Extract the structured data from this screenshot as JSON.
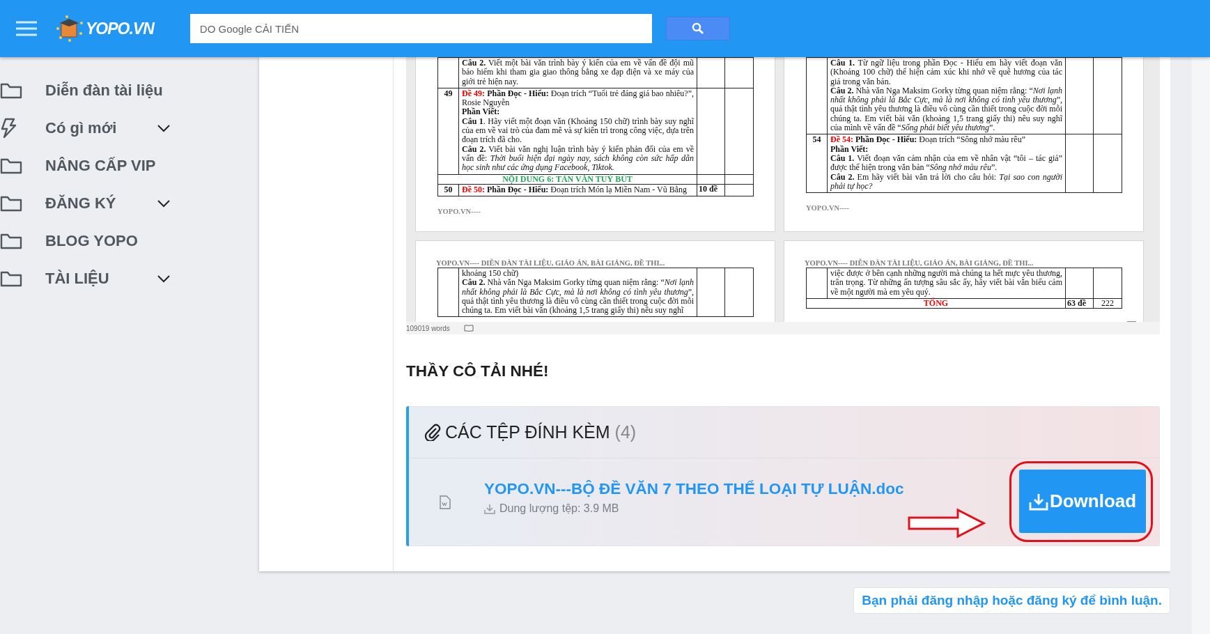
{
  "header": {
    "logo_text": "YOPO.VN",
    "search": {
      "placeholder": "DO Google CẢI TIẾN"
    }
  },
  "sidebar": {
    "items": [
      {
        "label": "Diễn đàn tài liệu",
        "kind": "folder",
        "expandable": false
      },
      {
        "label": "Có gì mới",
        "kind": "bolt",
        "expandable": true
      },
      {
        "label": "NÂNG CẤP VIP",
        "kind": "folder",
        "expandable": false
      },
      {
        "label": "ĐĂNG KÝ",
        "kind": "folder",
        "expandable": true
      },
      {
        "label": "BLOG YOPO",
        "kind": "folder",
        "expandable": false
      },
      {
        "label": "TÀI LIỆU",
        "kind": "folder",
        "expandable": true
      }
    ]
  },
  "document_preview": {
    "pages": [
      {
        "rows": [
          {
            "kind": "entry",
            "paragraphs": [
              {
                "text": "**Câu 2.** Viết một bài văn trình bày ý kiến của em về vấn đề đội mũ bảo hiểm khi tham gia giao thông bằng xe đạp điện và xe máy của giới trẻ hiện nay."
              }
            ]
          },
          {
            "kind": "entry",
            "number": "49",
            "paragraphs": [
              {
                "label": "Đề 49:",
                "text": "**Phần Đọc - Hiểu:** Đoạn trích “Tuổi trẻ đáng giá bao nhiêu?”, Rosie Nguyễn"
              },
              {
                "text": "**Phần Viết:**"
              },
              {
                "text": "**Câu 1**. Hãy viết một đoạn văn (Khoảng 150 chữ) trình bày suy nghĩ của em về vai trò của đam mê và sự kiên trì trong công việc, dựa trên đoạn trích đã cho."
              },
              {
                "text": "**Câu 2.** Viết bài văn nghị luận trình bày ý kiến phản đối của em về vấn đề: *Thời buổi hiện đại ngày nay, sách không còn sức hấp dẫn học sinh như các ứng dụng Facebook, Tiktok.*"
              }
            ]
          },
          {
            "kind": "section",
            "title": "NỘI DUNG 6: TẢN VĂN TUỲ BÚT"
          },
          {
            "kind": "entry",
            "number": "50",
            "paragraphs": [
              {
                "label": "Đề 50:",
                "text": "**Phần Đọc - Hiểu:** Đoạn trích Món lạ Miền Nam - Vũ Bằng"
              }
            ],
            "column_3": "10 đề"
          }
        ],
        "footer": "YOPO.VN----"
      },
      {
        "rows": [
          {
            "kind": "entry",
            "paragraphs": [
              {
                "text": "**Câu 1.** Từ ngữ liệu trong phần Đọc - Hiểu em hãy viết đoạn văn (Khoảng 100 chữ) thể hiện cảm xúc khi nhớ về quê hương của tác giả trong văn bản."
              },
              {
                "text": "**Câu 2.** Nhà văn Nga Maksim Gorky từng quan niệm rằng: “*Nơi lạnh nhất không phải là Bắc Cực, mà là nơi không có tình yêu thương*”, quả thật tình yêu thương là điều vô cùng cần thiết trong cuộc đời mỗi chúng ta. Em viết bài văn (khoảng 1,5 trang giấy thi) nêu suy nghĩ của mình về vấn đề “*Sống phải biết yêu thương*”."
              }
            ]
          },
          {
            "kind": "entry",
            "number": "54",
            "paragraphs": [
              {
                "label": "Đề 54:",
                "text": "**Phần Đọc - Hiểu:** Đoạn trích “Sông nhớ màu rêu”"
              },
              {
                "text": "**Phần Viết:**"
              },
              {
                "text": "**Câu 1.** Viết đoạn văn cảm nhận của em về nhân vật “tôi – tác giả” được thể hiện trong văn bản “*Sông nhớ màu rêu*”."
              },
              {
                "text": "**Câu 2.** Em hãy viết bài văn trả lời cho câu hỏi: *Tại sao con người phải tự học?*"
              }
            ]
          }
        ],
        "footer": "YOPO.VN----"
      },
      {
        "header": "YOPO.VN---- DIỄN ĐÀN TÀI LIỆU, GIÁO ÁN, BÀI GIẢNG, ĐỀ THI...",
        "rows": [
          {
            "kind": "entry",
            "paragraphs": [
              {
                "text": "khoảng 150 chữ)"
              },
              {
                "text": "**Câu 2.**  Nhà văn Nga Maksim Gorky từng quan niệm rằng: “*Nơi lạnh nhất không phải là Bắc Cực, mà là nơi không có tình yêu thương*”, quả thật tình yêu thương là điều vô cùng cần thiết trong cuộc đời mỗi chúng ta. Em viết bài văn (khoảng 1,5 trang giấy thi) nêu suy nghĩ"
              }
            ]
          }
        ]
      },
      {
        "header": "YOPO.VN---- DIỄN ĐÀN TÀI LIỆU, GIÁO ÁN, BÀI GIẢNG, ĐỀ THI...",
        "rows": [
          {
            "kind": "entry",
            "paragraphs": [
              {
                "text": "việc được ở bên cạnh những người mà chúng ta hết mực yêu thương, trân trọng. Từ những ấn tượng sâu sắc ấy, hãy viết bài văn biểu cảm về một người mà em yêu quý."
              }
            ]
          },
          {
            "kind": "total",
            "label": "TỔNG",
            "column_3": "63 đề",
            "column_4": "222"
          }
        ]
      }
    ],
    "word_count": "109019 words"
  },
  "heading": "THẦY CÔ TẢI NHÉ!",
  "attachments": {
    "title": "CÁC TỆP ĐÍNH KÈM",
    "count": "(4)",
    "files": [
      {
        "name": "YOPO.VN---BỘ ĐỀ VĂN 7 THEO THỂ LOẠI TỰ LUẬN.doc",
        "size": "Dung lượng tệp: 3.9 MB",
        "button": "Download"
      }
    ]
  },
  "comment_prompt": "Bạn phải đăng nhập hoặc đăng ký để bình luận."
}
